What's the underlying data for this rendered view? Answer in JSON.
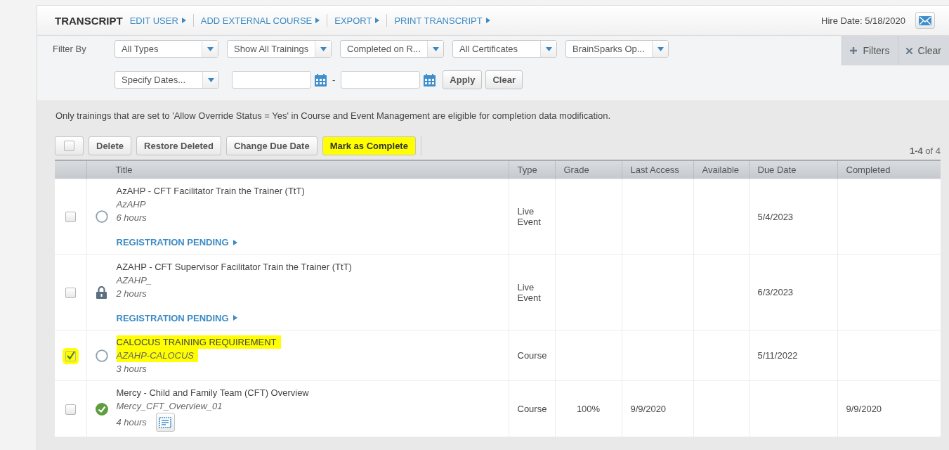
{
  "header": {
    "title": "TRANSCRIPT",
    "links": [
      "EDIT USER",
      "ADD EXTERNAL COURSE",
      "EXPORT",
      "PRINT TRANSCRIPT"
    ],
    "hire_date": "Hire Date: 5/18/2020"
  },
  "filters": {
    "label": "Filter By",
    "dropdowns": [
      "All Types",
      "Show All Trainings",
      "Completed on R...",
      "All Certificates",
      "BrainSparks Op..."
    ],
    "date_dropdown": "Specify Dates...",
    "range_separator": "-",
    "buttons": [
      "Apply",
      "Clear"
    ],
    "side_buttons": [
      {
        "kind": "plus",
        "label": "Filters"
      },
      {
        "kind": "x",
        "label": "Clear"
      }
    ]
  },
  "notice": "Only trainings that are set to 'Allow Override Status = Yes' in Course and Event Management are eligible for completion data modification.",
  "toolbar": {
    "select_all_checked": false,
    "buttons": [
      {
        "label": "Delete",
        "highlighted": false
      },
      {
        "label": "Restore Deleted",
        "highlighted": false
      },
      {
        "label": "Change Due Date",
        "highlighted": false
      },
      {
        "label": "Mark as Complete",
        "highlighted": true
      }
    ],
    "paging": "**1-4** of 4"
  },
  "table": {
    "columns": [
      "Title",
      "Type",
      "Grade",
      "Last Access",
      "Available",
      "Due Date",
      "Completed"
    ],
    "rows": [
      {
        "checked": false,
        "highlighted": false,
        "kind": "circle",
        "title": "AzAHP - CFT Facilitator Train the Trainer (TtT)",
        "code": "AzAHP",
        "duration": "6 hours",
        "certificate": false,
        "link": "REGISTRATION PENDING",
        "type": "Live Event",
        "grade": "",
        "last_access": "",
        "available": "",
        "due_date": "5/4/2023",
        "completed": ""
      },
      {
        "checked": false,
        "highlighted": false,
        "kind": "lock",
        "title": "AZAHP - CFT Supervisor Facilitator Train the Trainer (TtT)",
        "code": "AZAHP_",
        "duration": "2 hours",
        "certificate": false,
        "link": "REGISTRATION PENDING",
        "type": "Live Event",
        "grade": "",
        "last_access": "",
        "available": "",
        "due_date": "6/3/2023",
        "completed": ""
      },
      {
        "checked": true,
        "highlighted": true,
        "kind": "circle",
        "title": "CALOCUS TRAINING REQUIREMENT",
        "code": "AZAHP-CALOCUS",
        "duration": "3 hours",
        "certificate": false,
        "type": "Course",
        "grade": "",
        "last_access": "",
        "available": "",
        "due_date": "5/11/2022",
        "completed": ""
      },
      {
        "checked": false,
        "highlighted": false,
        "kind": "check",
        "title": "Mercy - Child and Family Team (CFT) Overview",
        "code": "Mercy_CFT_Overview_01",
        "duration": "4 hours",
        "certificate": true,
        "type": "Course",
        "grade": "100%",
        "last_access": "9/9/2020",
        "available": "",
        "due_date": "",
        "completed": "9/9/2020"
      }
    ]
  }
}
